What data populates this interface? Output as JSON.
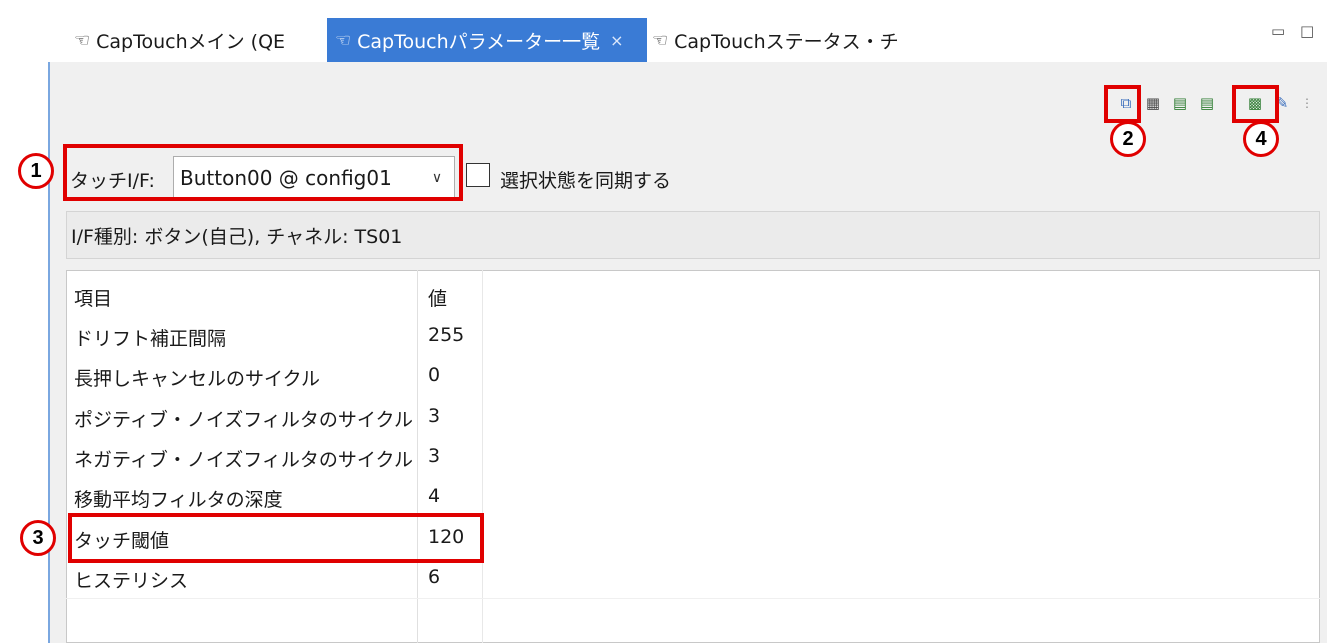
{
  "tabs": [
    {
      "label": "CapTouchメイン (QE",
      "icon": "hand-pointer-icon",
      "active": false
    },
    {
      "label": "CapTouchパラメーター一覧",
      "icon": "hand-pointer-icon",
      "active": true,
      "close": "×"
    },
    {
      "label": "CapTouchステータス・チ",
      "icon": "hand-pointer-icon",
      "active": false
    }
  ],
  "window_controls": {
    "minimize": "▭",
    "maximize": "□"
  },
  "toolbar": {
    "icons": [
      "refresh-monitor-icon",
      "table-view-icon",
      "export-table-icon",
      "import-table-icon",
      "apply-parameters-icon",
      "write-tool-icon",
      "view-menu-icon"
    ]
  },
  "touch_if": {
    "label": "タッチI/F:",
    "selected": "Button00 @ config01",
    "chevron": "∨"
  },
  "sync": {
    "label": "選択状態を同期する",
    "checked": false
  },
  "info_bar": "I/F種別: ボタン(自己), チャネル: TS01",
  "table": {
    "headers": [
      "項目",
      "値"
    ],
    "rows": [
      {
        "item": "ドリフト補正間隔",
        "value": "255"
      },
      {
        "item": "長押しキャンセルのサイクル",
        "value": "0"
      },
      {
        "item": "ポジティブ・ノイズフィルタのサイクル",
        "value": "3"
      },
      {
        "item": "ネガティブ・ノイズフィルタのサイクル",
        "value": "3"
      },
      {
        "item": "移動平均フィルタの深度",
        "value": "4"
      },
      {
        "item": "タッチ閾値",
        "value": "120"
      },
      {
        "item": "ヒステリシス",
        "value": "6"
      }
    ]
  },
  "annotations": [
    "1",
    "2",
    "3",
    "4"
  ],
  "colors": {
    "accent": "#3a7bd5",
    "annotation": "#e00000"
  }
}
